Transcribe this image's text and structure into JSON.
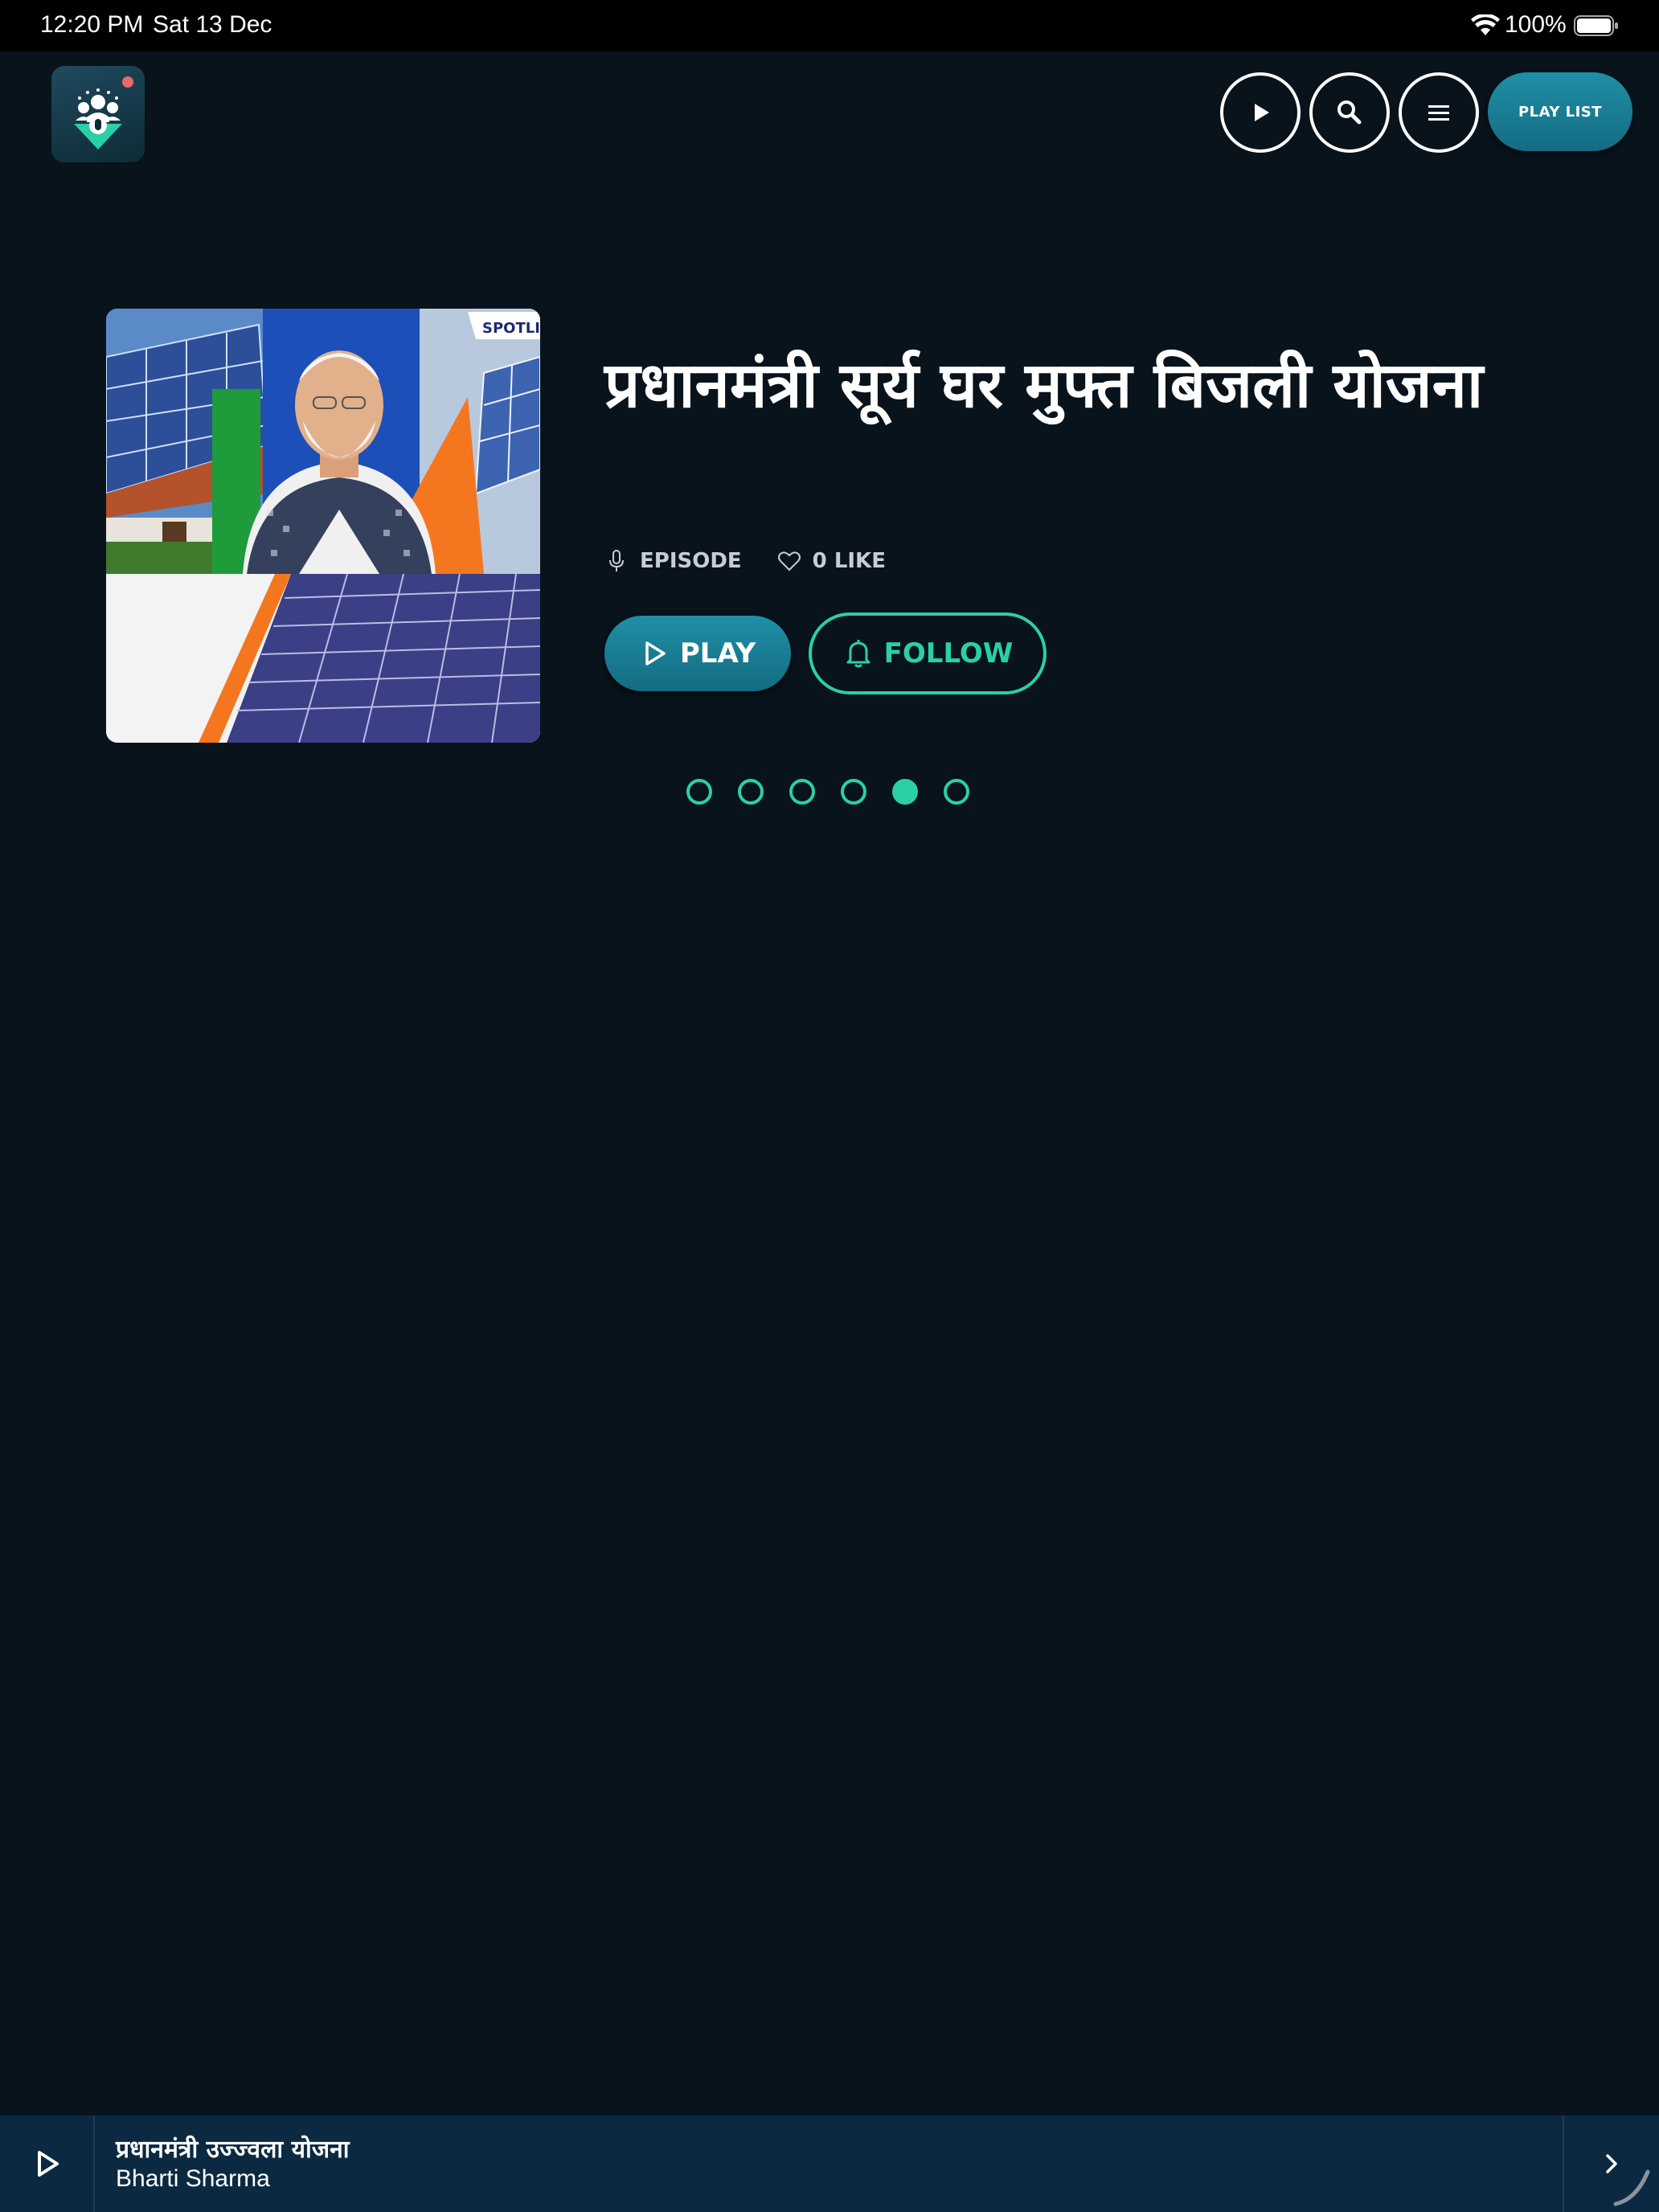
{
  "status_bar": {
    "time": "12:20 PM",
    "date": "Sat 13 Dec",
    "battery": "100%"
  },
  "header": {
    "playlist_label": "PLAY LIST"
  },
  "hero": {
    "image_badge": "SPOTLI",
    "title": "प्रधानमंत्री सूर्य घर मुफ्त बिजली योजना",
    "meta_type": "EPISODE",
    "meta_likes": "0 LIKE",
    "play_label": "PLAY",
    "follow_label": "FOLLOW",
    "slides_total": 6,
    "active_slide": 5
  },
  "player": {
    "title": "प्रधानमंत्री उज्ज्वला योजना",
    "artist": "Bharti Sharma"
  },
  "colors": {
    "background": "#08131c",
    "accent_teal": "#2ad0a4",
    "button_gradient": "#1f8fa6",
    "player_bar": "#0b2a42"
  },
  "icons": [
    "wifi-icon",
    "battery-icon",
    "podcast-logo",
    "play-icon",
    "search-icon",
    "menu-icon",
    "microphone-icon",
    "heart-icon",
    "bell-icon",
    "chevron-right-icon"
  ]
}
